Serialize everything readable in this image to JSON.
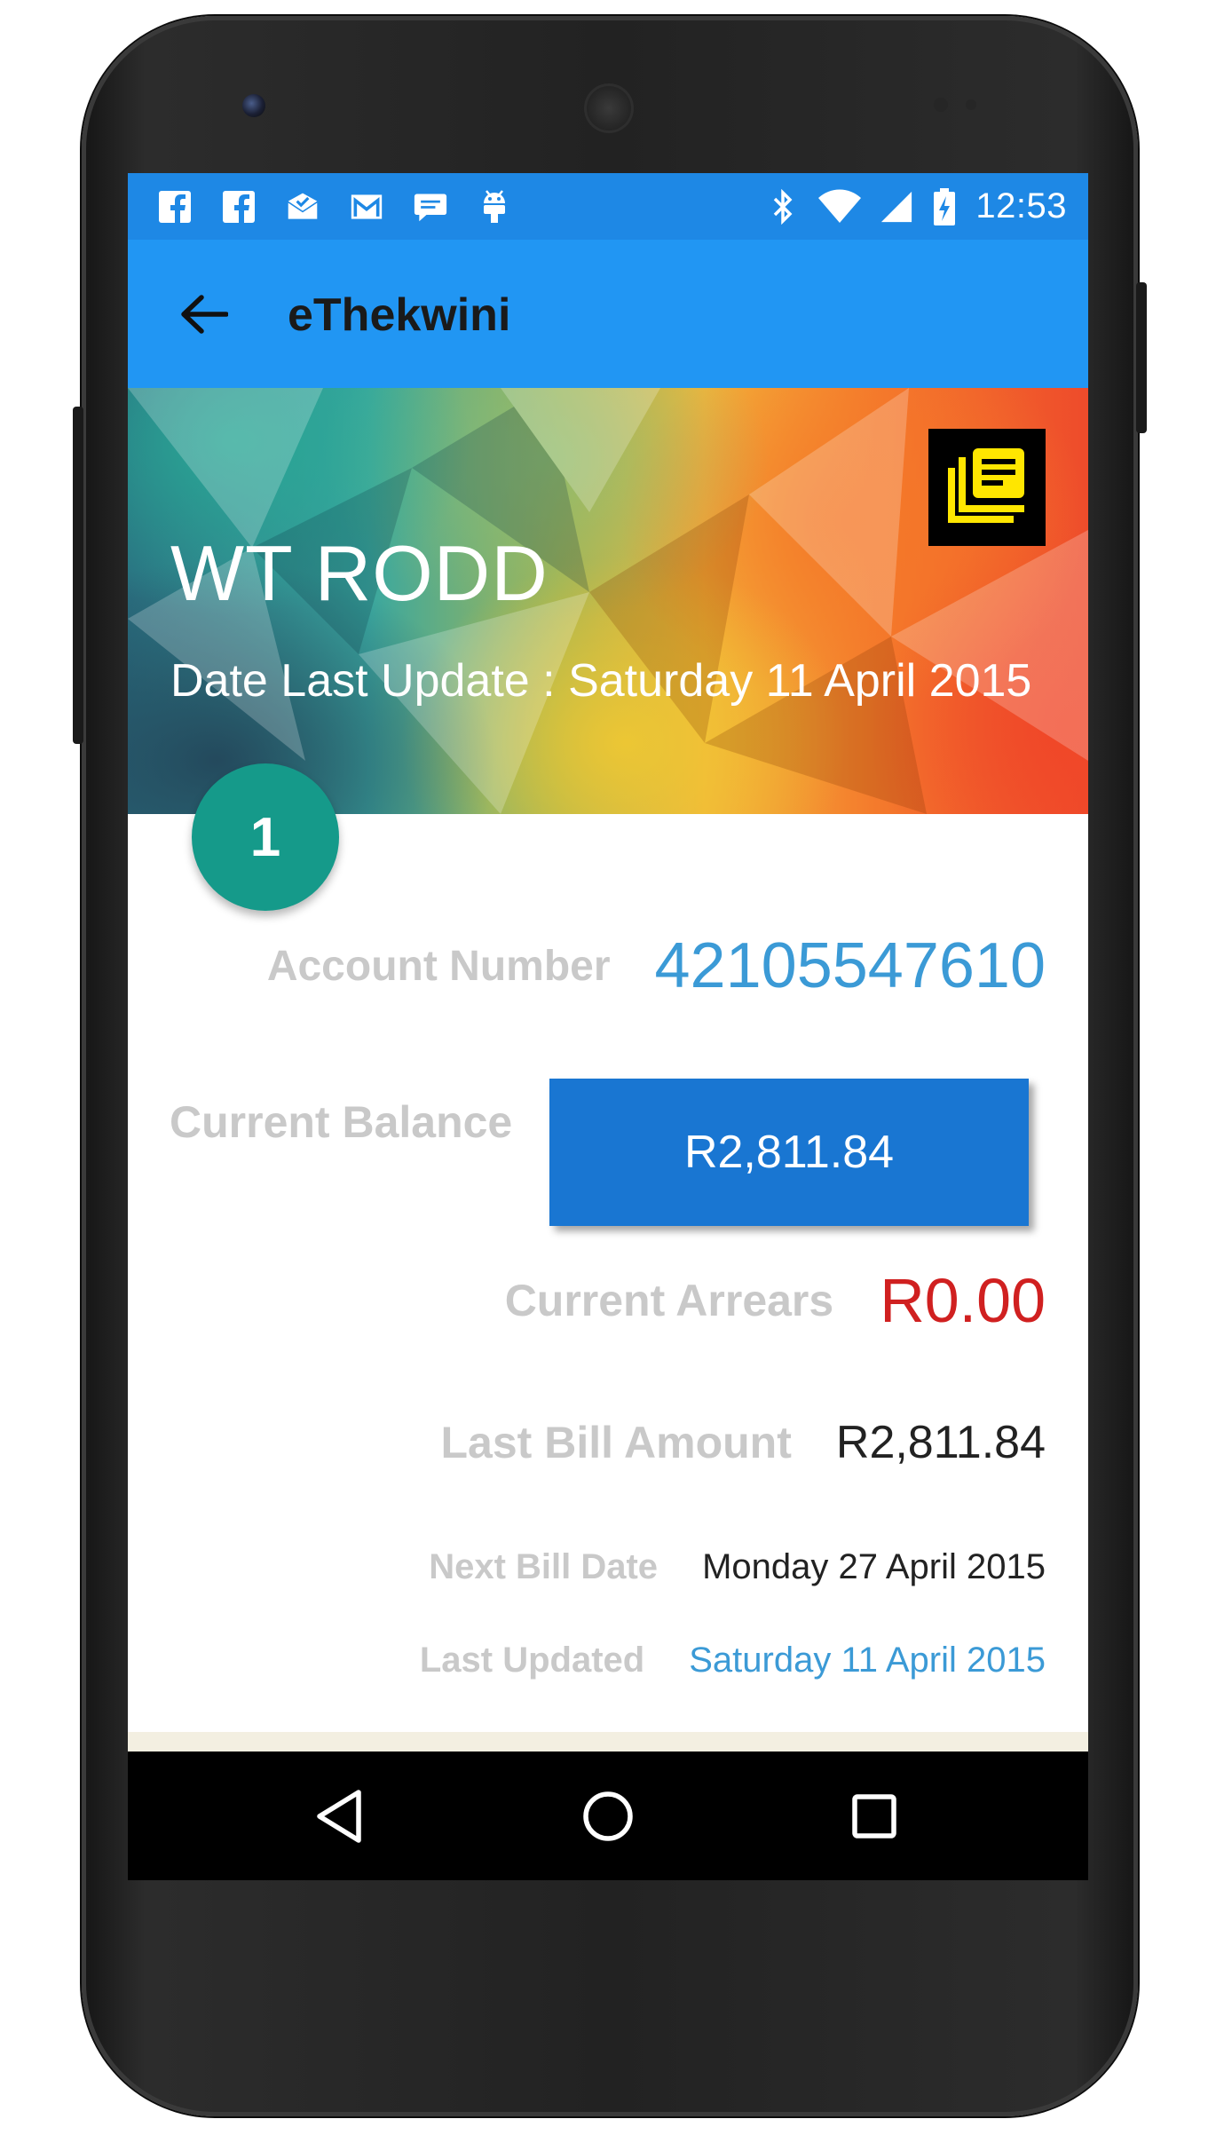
{
  "status_bar": {
    "time": "12:53",
    "left_icons": [
      "facebook-icon",
      "facebook-icon",
      "inbox-check-icon",
      "gmail-icon",
      "chat-icon",
      "android-debug-icon"
    ],
    "right_icons": [
      "bluetooth-icon",
      "wifi-icon",
      "signal-icon",
      "battery-charging-icon"
    ]
  },
  "app_bar": {
    "title": "eThekwini",
    "background": "#2196f3"
  },
  "hero": {
    "name": "WT RODD",
    "date_label": "Date Last Update :",
    "date_value": "Saturday 11 April 2015"
  },
  "badge": {
    "number": "1",
    "color": "#159a8a"
  },
  "account": {
    "account_number_label": "Account Number",
    "account_number": "42105547610",
    "current_balance_label": "Current Balance",
    "current_balance": "R2,811.84",
    "current_arrears_label": "Current Arrears",
    "current_arrears": "R0.00",
    "last_bill_amount_label": "Last Bill Amount",
    "last_bill_amount": "R2,811.84",
    "next_bill_date_label": "Next Bill Date",
    "next_bill_date": "Monday 27 April 2015",
    "last_updated_label": "Last Updated",
    "last_updated": "Saturday 11 April 2015"
  },
  "colors": {
    "accent_blue": "#3b9ad6",
    "button_blue": "#1976d2",
    "arrears_red": "#d02020",
    "label_grey": "#c9c9c9"
  },
  "nav": [
    "back-nav-icon",
    "home-nav-icon",
    "recents-nav-icon"
  ]
}
